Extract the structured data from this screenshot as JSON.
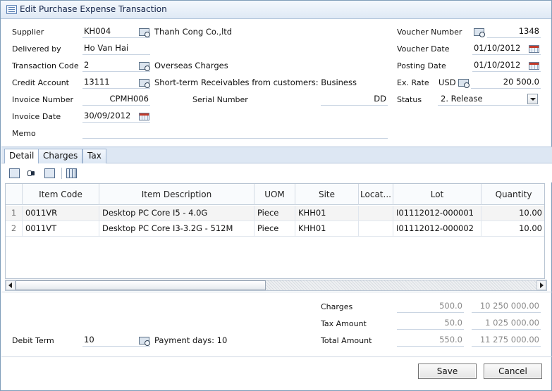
{
  "window": {
    "title": "Edit Purchase Expense Transaction"
  },
  "header": {
    "supplier": {
      "label": "Supplier",
      "code": "KH004",
      "name": "Thanh Cong Co.,ltd"
    },
    "delivered_by": {
      "label": "Delivered by",
      "value": "Ho Van Hai"
    },
    "transaction_code": {
      "label": "Transaction Code",
      "code": "2",
      "name": "Overseas Charges"
    },
    "credit_account": {
      "label": "Credit Account",
      "code": "13111",
      "name": "Short-term Receivables from customers: Business"
    },
    "invoice_number": {
      "label": "Invoice Number",
      "value": "CPMH006"
    },
    "serial_number": {
      "label": "Serial Number",
      "value": "DD"
    },
    "invoice_date": {
      "label": "Invoice Date",
      "value": "30/09/2012"
    },
    "memo": {
      "label": "Memo",
      "value": ""
    },
    "voucher_number": {
      "label": "Voucher Number",
      "value": "1348"
    },
    "voucher_date": {
      "label": "Voucher Date",
      "value": "01/10/2012"
    },
    "posting_date": {
      "label": "Posting Date",
      "value": "01/10/2012"
    },
    "ex_rate": {
      "label": "Ex. Rate",
      "currency": "USD",
      "value": "20 500.0"
    },
    "status": {
      "label": "Status",
      "value": "2. Release"
    }
  },
  "tabs": [
    {
      "label": "Detail",
      "active": true
    },
    {
      "label": "Charges",
      "active": false
    },
    {
      "label": "Tax",
      "active": false
    }
  ],
  "toolbar_icons": [
    "delete-row-icon",
    "find-icon",
    "grid-edit-icon",
    "columns-icon"
  ],
  "grid": {
    "columns": [
      "Item Code",
      "Item Description",
      "UOM",
      "Site",
      "Locat...",
      "Lot",
      "Quantity"
    ],
    "rows": [
      {
        "n": "1",
        "item_code": "0011VR",
        "description": "Desktop PC  Core I5 - 4.0G",
        "uom": "Piece",
        "site": "KHH01",
        "location": "",
        "lot": "I01112012-000001",
        "quantity": "10.00"
      },
      {
        "n": "2",
        "item_code": "0011VT",
        "description": "Desktop PC Core I3-3.2G - 512M",
        "uom": "Piece",
        "site": "KHH01",
        "location": "",
        "lot": "I01112012-000002",
        "quantity": "10.00"
      }
    ]
  },
  "footer": {
    "debit_term": {
      "label": "Debit Term",
      "value": "10",
      "payment_days": "Payment days: 10"
    },
    "charges": {
      "label": "Charges",
      "fc": "500.0",
      "lc": "10 250 000.00"
    },
    "tax_amount": {
      "label": "Tax Amount",
      "fc": "50.0",
      "lc": "1 025 000.00"
    },
    "total_amount": {
      "label": "Total Amount",
      "fc": "550.0",
      "lc": "11 275 000.00"
    }
  },
  "buttons": {
    "save": "Save",
    "cancel": "Cancel"
  }
}
